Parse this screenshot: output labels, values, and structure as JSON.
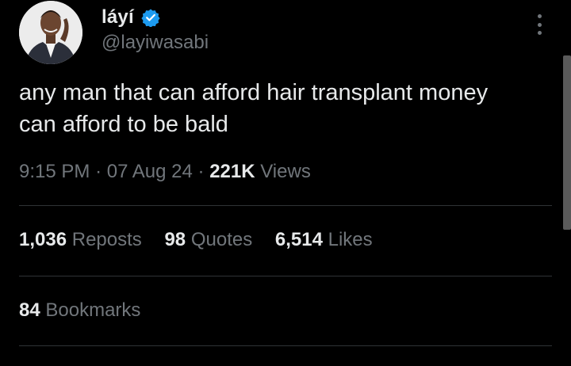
{
  "author": {
    "display_name": "láyí",
    "handle": "@layiwasabi",
    "verified_icon": "verified-badge-icon",
    "verified_color": "#1d9bf0"
  },
  "tweet": {
    "text_line1": "any man that can afford hair transplant money",
    "text_line2": "can afford to be bald"
  },
  "meta": {
    "time": "9:15 PM",
    "separator": "·",
    "date": "07 Aug 24",
    "views_count": "221K",
    "views_label": "Views"
  },
  "stats": {
    "reposts_count": "1,036",
    "reposts_label": "Reposts",
    "quotes_count": "98",
    "quotes_label": "Quotes",
    "likes_count": "6,514",
    "likes_label": "Likes",
    "bookmarks_count": "84",
    "bookmarks_label": "Bookmarks"
  },
  "colors": {
    "background": "#000000",
    "primary_text": "#e7e9ea",
    "secondary_text": "#71767b",
    "divider": "#2f3336"
  }
}
